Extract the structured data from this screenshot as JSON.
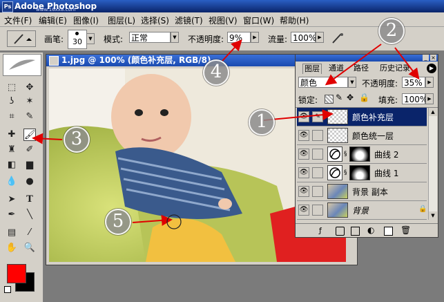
{
  "app": {
    "title": "Adobe Photoshop",
    "watermark": "www.16xx8.com"
  },
  "menu": [
    "文件(F)",
    "编辑(E)",
    "图像(I)",
    "图层(L)",
    "选择(S)",
    "滤镜(T)",
    "视图(V)",
    "窗口(W)",
    "帮助(H)"
  ],
  "options": {
    "brush_label": "画笔:",
    "brush_size": "30",
    "mode_label": "模式:",
    "mode_value": "正常",
    "opacity_label": "不透明度:",
    "opacity_value": "9%",
    "flow_label": "流量:",
    "flow_value": "100%"
  },
  "document": {
    "title": "1.jpg @ 100% (颜色补充层, RGB/8)"
  },
  "layers_panel": {
    "tabs": [
      "图层",
      "通道",
      "路径",
      "历史记录"
    ],
    "blend_mode": "颜色",
    "opacity_label": "不透明度:",
    "opacity_value": "35%",
    "lock_label": "锁定:",
    "fill_label": "填充:",
    "fill_value": "100%",
    "layers": [
      {
        "name": "颜色补充层"
      },
      {
        "name": "颜色统一层"
      },
      {
        "name": "曲线 2"
      },
      {
        "name": "曲线 1"
      },
      {
        "name": "背景 副本"
      },
      {
        "name": "背景"
      }
    ]
  },
  "colors": {
    "foreground": "#ff0000",
    "background": "#000000",
    "selected_layer": "#0a246a",
    "arrow": "#e00000"
  },
  "callouts": [
    "1",
    "2",
    "3",
    "4",
    "5"
  ]
}
